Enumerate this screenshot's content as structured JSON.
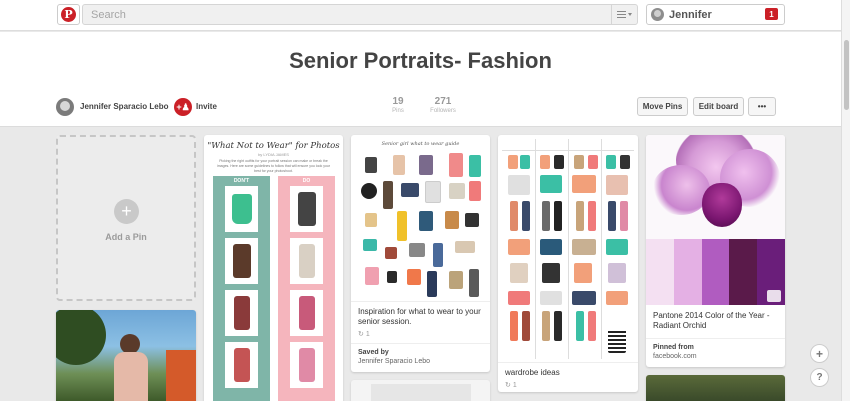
{
  "topbar": {
    "logo": "P",
    "search_placeholder": "Search",
    "user_name": "Jennifer",
    "notification_count": "1"
  },
  "board": {
    "title": "Senior Portraits- Fashion",
    "owner": "Jennifer Sparacio Lebo",
    "invite_label": "Invite",
    "pins_count": "19",
    "pins_label": "Pins",
    "followers_count": "271",
    "followers_label": "Followers",
    "move_pins_label": "Move Pins",
    "edit_board_label": "Edit board",
    "more_label": "•••"
  },
  "add_pin": {
    "icon": "+",
    "label": "Add a Pin"
  },
  "pins": [
    {
      "title": "\"What Not to Wear\" for Photos",
      "byline": "by LYDIA JAMES",
      "intro": "Picking the right outfits for your portrait session can make or break the images. Here are some guidelines to follow that will ensure you look your best for your photoshoot.",
      "dont": "DON'T",
      "do": "DO"
    },
    {
      "header": "Senior girl what to wear guide",
      "description": "Inspiration for what to wear to your senior session.",
      "repins": "1",
      "saved_by_label": "Saved by",
      "saved_by": "Jennifer Sparacio Lebo"
    },
    {
      "description": "wardrobe ideas",
      "repins": "1"
    },
    {
      "description": "Pantone 2014 Color of the Year - Radiant Orchid",
      "pinned_from_label": "Pinned from",
      "pinned_from": "facebook.com"
    }
  ],
  "floating": {
    "add": "+",
    "help": "?"
  },
  "colors": {
    "brand_red": "#cb2027",
    "teal": "#7fb5a8",
    "pink": "#f5b5bd",
    "orchid": "#b05cc0"
  }
}
